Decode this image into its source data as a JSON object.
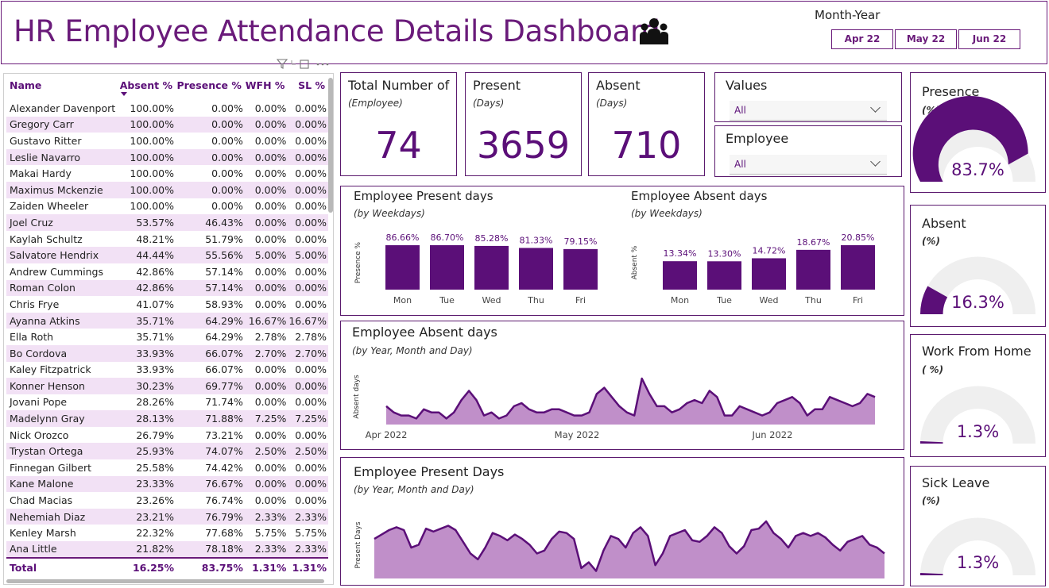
{
  "header": {
    "title": "HR Employee Attendance Details Dashboard",
    "icon": "people-group-icon",
    "month_year_label": "Month-Year",
    "month_buttons": [
      "Apr 22",
      "May 22",
      "Jun 22"
    ]
  },
  "colors": {
    "accent": "#5b0f78",
    "area_fill": "#c08fc9",
    "gauge_track": "#efefef",
    "row_band": "#f2e1f5"
  },
  "table": {
    "columns": [
      "Name",
      "Absent %",
      "Presence %",
      "WFH %",
      "SL %"
    ],
    "sorted_column": "Absent %",
    "rows": [
      [
        "Alexander Davenport",
        "100.00%",
        "0.00%",
        "0.00%",
        "0.00%"
      ],
      [
        "Gregory Carr",
        "100.00%",
        "0.00%",
        "0.00%",
        "0.00%"
      ],
      [
        "Gustavo Ritter",
        "100.00%",
        "0.00%",
        "0.00%",
        "0.00%"
      ],
      [
        "Leslie Navarro",
        "100.00%",
        "0.00%",
        "0.00%",
        "0.00%"
      ],
      [
        "Makai Hardy",
        "100.00%",
        "0.00%",
        "0.00%",
        "0.00%"
      ],
      [
        "Maximus Mckenzie",
        "100.00%",
        "0.00%",
        "0.00%",
        "0.00%"
      ],
      [
        "Zaiden Wheeler",
        "100.00%",
        "0.00%",
        "0.00%",
        "0.00%"
      ],
      [
        "Joel Cruz",
        "53.57%",
        "46.43%",
        "0.00%",
        "0.00%"
      ],
      [
        "Kaylah Schultz",
        "48.21%",
        "51.79%",
        "0.00%",
        "0.00%"
      ],
      [
        "Salvatore Hendrix",
        "44.44%",
        "55.56%",
        "5.00%",
        "5.00%"
      ],
      [
        "Andrew Cummings",
        "42.86%",
        "57.14%",
        "0.00%",
        "0.00%"
      ],
      [
        "Roman Colon",
        "42.86%",
        "57.14%",
        "0.00%",
        "0.00%"
      ],
      [
        "Chris Frye",
        "41.07%",
        "58.93%",
        "0.00%",
        "0.00%"
      ],
      [
        "Ayanna Atkins",
        "35.71%",
        "64.29%",
        "16.67%",
        "16.67%"
      ],
      [
        "Ella Roth",
        "35.71%",
        "64.29%",
        "2.78%",
        "2.78%"
      ],
      [
        "Bo Cordova",
        "33.93%",
        "66.07%",
        "2.70%",
        "2.70%"
      ],
      [
        "Kaley Fitzpatrick",
        "33.93%",
        "66.07%",
        "0.00%",
        "0.00%"
      ],
      [
        "Konner Henson",
        "30.23%",
        "69.77%",
        "0.00%",
        "0.00%"
      ],
      [
        "Jovani Pope",
        "28.26%",
        "71.74%",
        "0.00%",
        "0.00%"
      ],
      [
        "Madelynn Gray",
        "28.13%",
        "71.88%",
        "7.25%",
        "7.25%"
      ],
      [
        "Nick Orozco",
        "26.79%",
        "73.21%",
        "0.00%",
        "0.00%"
      ],
      [
        "Trystan Ortega",
        "25.93%",
        "74.07%",
        "2.50%",
        "2.50%"
      ],
      [
        "Finnegan Gilbert",
        "25.58%",
        "74.42%",
        "0.00%",
        "0.00%"
      ],
      [
        "Kane Malone",
        "23.33%",
        "76.67%",
        "0.00%",
        "0.00%"
      ],
      [
        "Chad Macias",
        "23.26%",
        "76.74%",
        "0.00%",
        "0.00%"
      ],
      [
        "Nehemiah Diaz",
        "23.21%",
        "76.79%",
        "2.33%",
        "2.33%"
      ],
      [
        "Kenley Marsh",
        "22.32%",
        "77.68%",
        "5.75%",
        "5.75%"
      ],
      [
        "Ana Little",
        "21.82%",
        "78.18%",
        "2.33%",
        "2.33%"
      ]
    ],
    "total": [
      "Total",
      "16.25%",
      "83.75%",
      "1.31%",
      "1.31%"
    ]
  },
  "kpis": {
    "employees": {
      "title": "Total Number of",
      "sub": "(Employee)",
      "value": "74"
    },
    "present": {
      "title": "Present",
      "sub": "(Days)",
      "value": "3659"
    },
    "absent": {
      "title": "Absent",
      "sub": "(Days)",
      "value": "710"
    }
  },
  "slicers": {
    "values": {
      "label": "Values",
      "selected": "All"
    },
    "employee": {
      "label": "Employee",
      "selected": "All"
    }
  },
  "gauges": [
    {
      "title": "Presence",
      "sub": "(%)",
      "value_text": "83.7%",
      "fraction": 0.837
    },
    {
      "title": "Absent",
      "sub": "(%)",
      "value_text": "16.3%",
      "fraction": 0.163
    },
    {
      "title": "Work From Home",
      "sub": "( %)",
      "value_text": "1.3%",
      "fraction": 0.013
    },
    {
      "title": "Sick Leave",
      "sub": "(%)",
      "value_text": "1.3%",
      "fraction": 0.013
    }
  ],
  "chart_data": [
    {
      "type": "bar",
      "title": "Employee Present days",
      "subtitle": "(by Weekdays)",
      "ylabel": "Presence %",
      "categories": [
        "Mon",
        "Tue",
        "Wed",
        "Thu",
        "Fri"
      ],
      "values": [
        86.66,
        86.7,
        85.28,
        81.33,
        79.15
      ],
      "labels": [
        "86.66%",
        "86.70%",
        "85.28%",
        "81.33%",
        "79.15%"
      ],
      "ylim": [
        0,
        100
      ]
    },
    {
      "type": "bar",
      "title": "Employee Absent days",
      "subtitle": "(by Weekdays)",
      "ylabel": "Absent %",
      "categories": [
        "Mon",
        "Tue",
        "Wed",
        "Thu",
        "Fri"
      ],
      "values": [
        13.34,
        13.3,
        14.72,
        18.67,
        20.85
      ],
      "labels": [
        "13.34%",
        "13.30%",
        "14.72%",
        "18.67%",
        "20.85%"
      ],
      "ylim": [
        0,
        25
      ]
    },
    {
      "type": "area",
      "title": "Employee Absent days",
      "subtitle": "(by Year, Month and Day)",
      "ylabel": "Absent days",
      "x_ticks": [
        "Apr 2022",
        "May 2022",
        "Jun 2022"
      ],
      "values": [
        11,
        9,
        8,
        8,
        7,
        10,
        9,
        9,
        7,
        9,
        13,
        16,
        13,
        8,
        9,
        7,
        8,
        11,
        12,
        10,
        9,
        9,
        10,
        10,
        9,
        8,
        8,
        9,
        15,
        17,
        14,
        11,
        9,
        8,
        20,
        15,
        11,
        11,
        9,
        10,
        12,
        13,
        12,
        16,
        14,
        8,
        8,
        11,
        10,
        9,
        8,
        9,
        12,
        13,
        14,
        12,
        8,
        10,
        10,
        14,
        13,
        12,
        11,
        12,
        15,
        14
      ]
    },
    {
      "type": "area",
      "title": "Employee Present Days",
      "subtitle": "(by Year, Month and Day)",
      "ylabel": "Present Days",
      "values": [
        58,
        61,
        64,
        66,
        64,
        52,
        54,
        65,
        63,
        65,
        67,
        64,
        56,
        48,
        44,
        52,
        62,
        60,
        57,
        61,
        58,
        54,
        48,
        50,
        58,
        63,
        62,
        58,
        38,
        42,
        36,
        50,
        60,
        58,
        52,
        62,
        66,
        60,
        40,
        48,
        60,
        62,
        64,
        57,
        56,
        60,
        66,
        62,
        53,
        48,
        53,
        64,
        65,
        70,
        62,
        58,
        52,
        60,
        62,
        60,
        62,
        59,
        54,
        50,
        56,
        58,
        60,
        54,
        52,
        48
      ]
    }
  ]
}
